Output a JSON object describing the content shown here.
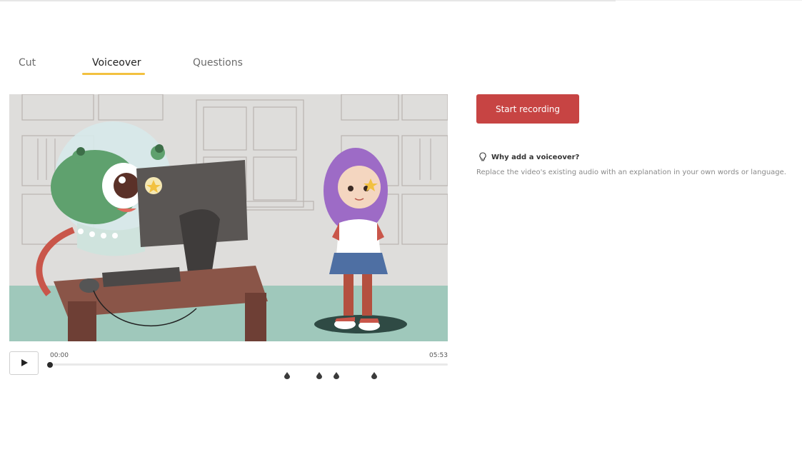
{
  "tabs": [
    {
      "label": "Cut",
      "active": false
    },
    {
      "label": "Voiceover",
      "active": true
    },
    {
      "label": "Questions",
      "active": false
    }
  ],
  "accent_colors": {
    "tab_underline": "#f2c140",
    "record_button": "#c74443"
  },
  "player": {
    "play_icon": "play-icon",
    "current_time": "00:00",
    "duration": "05:53",
    "progress": 0,
    "question_marker_count": 4
  },
  "sidebar": {
    "record_label": "Start recording",
    "help_icon": "lightbulb-icon",
    "help_title": "Why add a voiceover?",
    "help_text": "Replace the video's existing audio with an explanation in your own words or language."
  }
}
